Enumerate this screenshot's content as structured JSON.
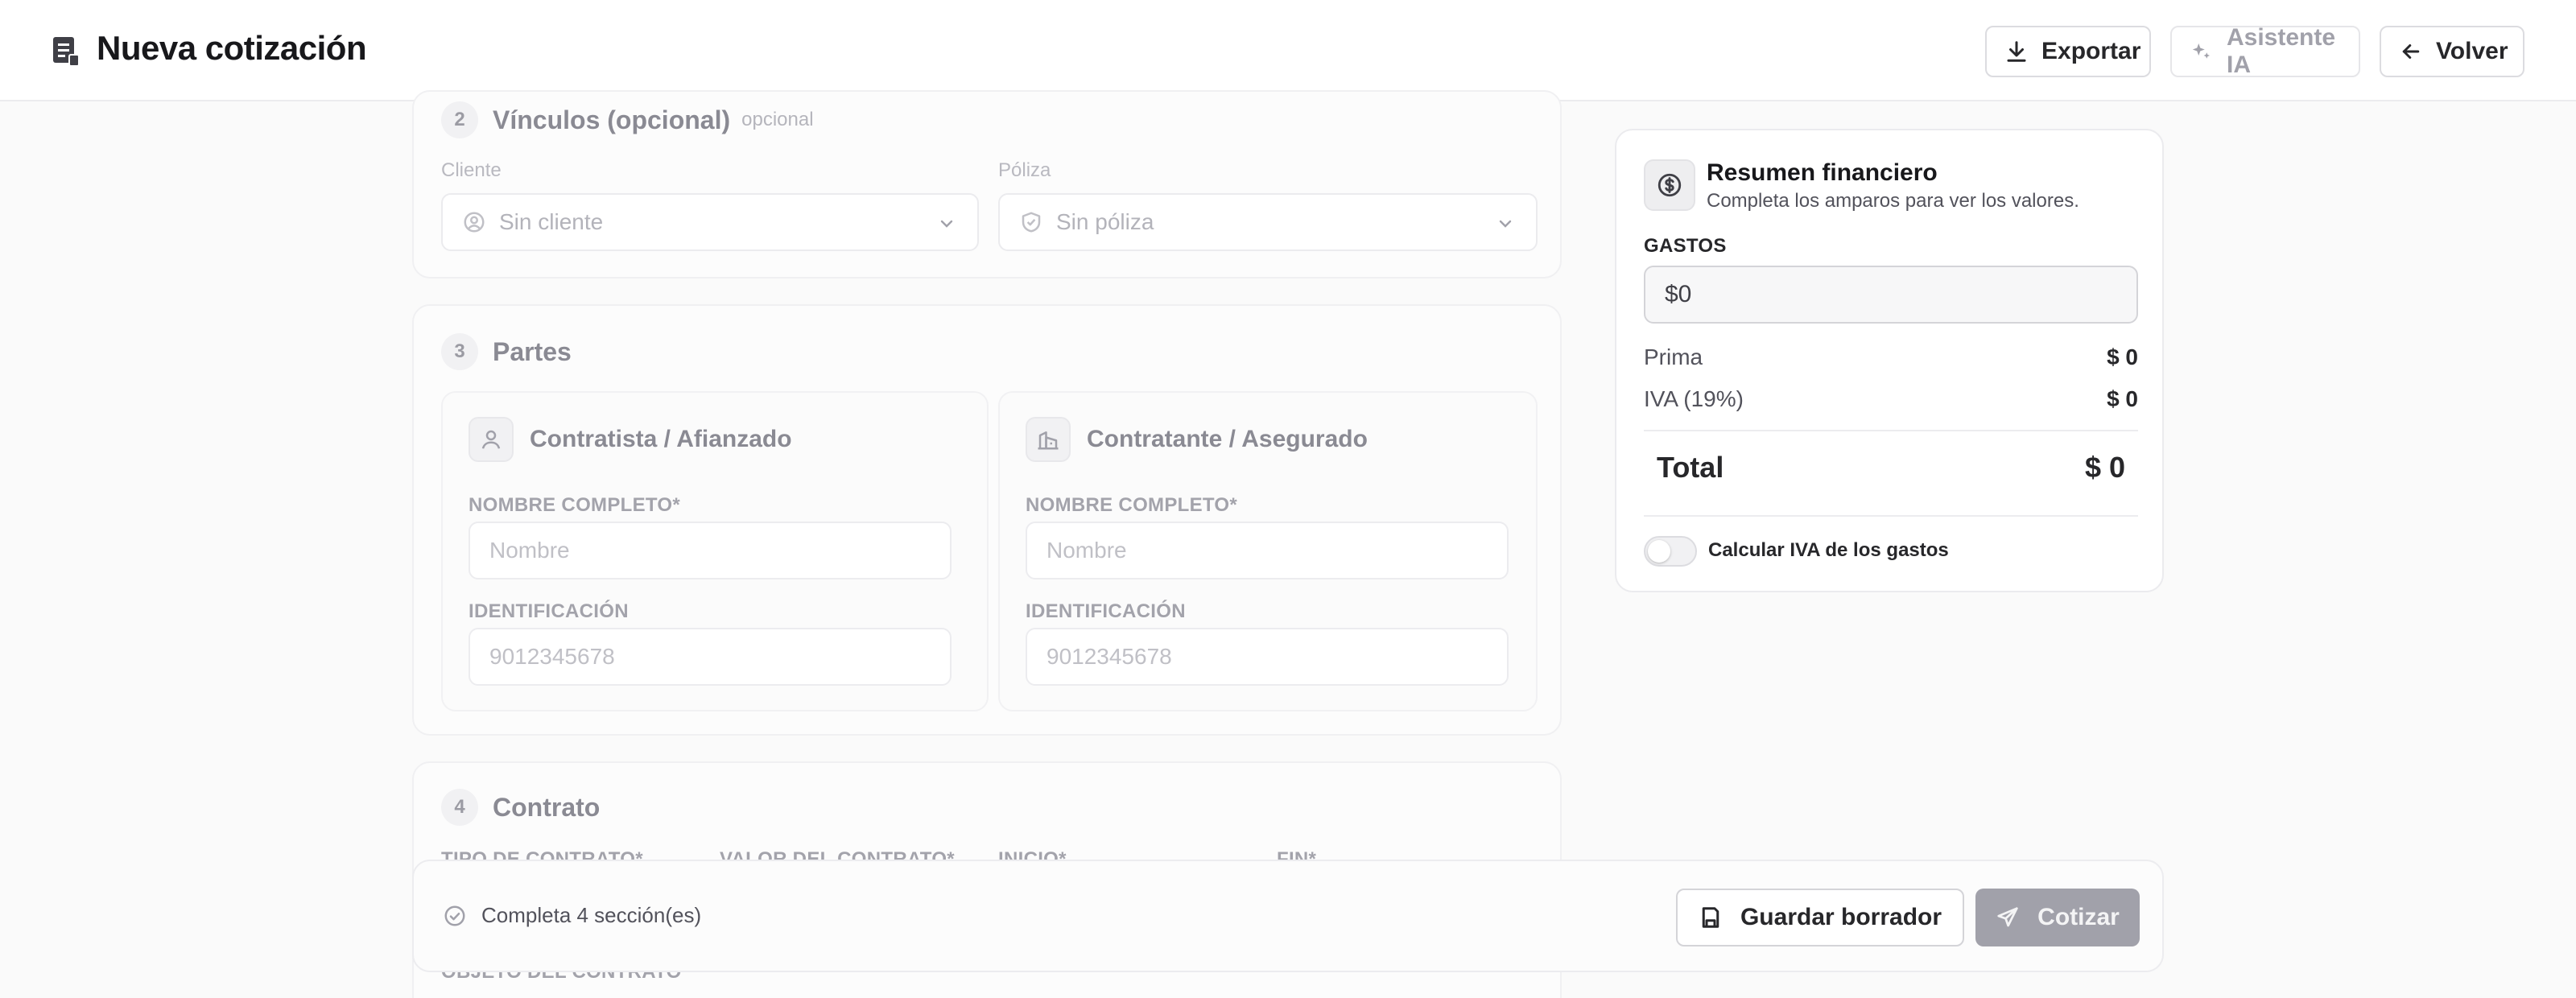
{
  "header": {
    "title": "Nueva cotización",
    "export_label": "Exportar",
    "assistant_label": "Asistente IA",
    "back_label": "Volver"
  },
  "sections": {
    "vinculos": {
      "number": "2",
      "title": "Vínculos (opcional)",
      "tag": "opcional",
      "client_label": "Cliente",
      "client_value": "Sin cliente",
      "policy_label": "Póliza",
      "policy_value": "Sin póliza"
    },
    "partes": {
      "number": "3",
      "title": "Partes",
      "contratista": {
        "title": "Contratista / Afianzado",
        "name_label": "NOMBRE COMPLETO*",
        "name_placeholder": "Nombre",
        "id_label": "IDENTIFICACIÓN",
        "id_placeholder": "9012345678"
      },
      "contratante": {
        "title": "Contratante / Asegurado",
        "name_label": "NOMBRE COMPLETO*",
        "name_placeholder": "Nombre",
        "id_label": "IDENTIFICACIÓN",
        "id_placeholder": "9012345678"
      }
    },
    "contrato": {
      "number": "4",
      "title": "Contrato",
      "type_label": "TIPO DE CONTRATO*",
      "value_label": "VALOR DEL CONTRATO*",
      "start_label": "INICIO*",
      "end_label": "FIN*",
      "object_label": "OBJETO DEL CONTRATO"
    }
  },
  "summary": {
    "title": "Resumen financiero",
    "subtitle": "Completa los amparos para ver los valores.",
    "expenses_label": "GASTOS",
    "expenses_value": "$0",
    "prima_label": "Prima",
    "prima_value": "$ 0",
    "iva_label": "IVA (19%)",
    "iva_value": "$ 0",
    "total_label": "Total",
    "total_value": "$ 0",
    "toggle_label": "Calcular IVA de los gastos",
    "toggle_on": false
  },
  "actionbar": {
    "status": "Completa 4 sección(es)",
    "draft_label": "Guardar borrador",
    "quote_label": "Cotizar"
  }
}
